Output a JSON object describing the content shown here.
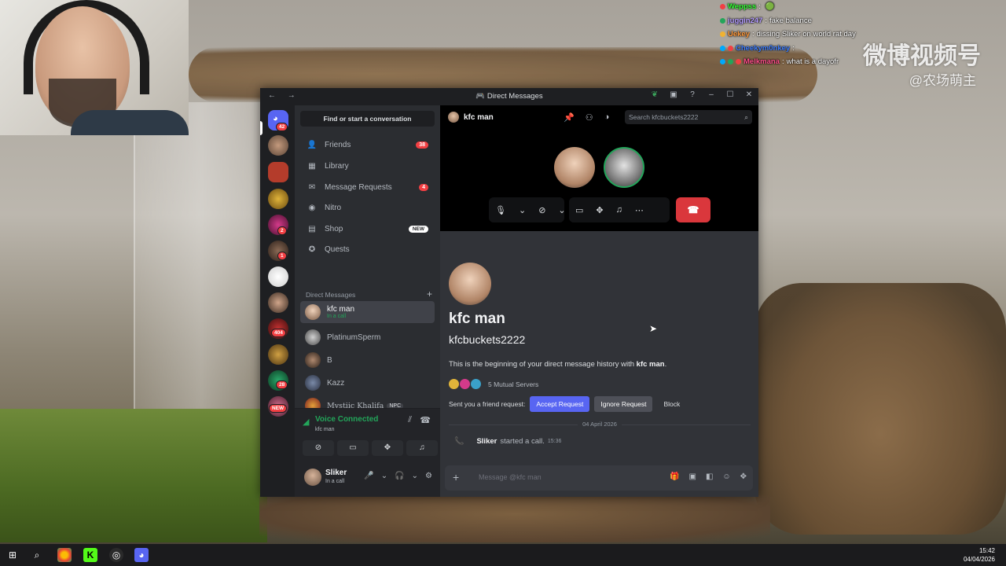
{
  "chat_overlay": {
    "lines": [
      {
        "user": "Weppss",
        "msg": "",
        "color": "#33ff33"
      },
      {
        "user": "juggin247",
        "msg": "fake balance",
        "color": "#b49cff"
      },
      {
        "user": "Uekey",
        "msg": "dissing Sliker on world rat day",
        "color": "#ff9a3c"
      },
      {
        "user": "Cheekym0nkey",
        "msg": "",
        "color": "#3c7dff"
      },
      {
        "user": "Melkmana",
        "msg": "what is a dayofr",
        "color": "#ff4f8b"
      }
    ],
    "watermark": "微博视频号",
    "watermark_handle": "@农场萌主"
  },
  "window": {
    "title": "Direct Messages",
    "nav": "← →"
  },
  "servers": [
    {
      "badge": "42"
    },
    {
      "badge": ""
    },
    {
      "badge": ""
    },
    {
      "badge": ""
    },
    {
      "badge": "2"
    },
    {
      "badge": "1"
    },
    {
      "badge": ""
    },
    {
      "badge": ""
    },
    {
      "badge": "404"
    },
    {
      "badge": ""
    },
    {
      "badge": "28"
    },
    {
      "badge": "NEW"
    }
  ],
  "sidebar": {
    "find_placeholder": "Find or start a conversation",
    "items": [
      {
        "label": "Friends",
        "icon": "friends-icon",
        "count": "38"
      },
      {
        "label": "Library",
        "icon": "library-icon",
        "count": ""
      },
      {
        "label": "Message Requests",
        "icon": "message-requests-icon",
        "count": "4"
      },
      {
        "label": "Nitro",
        "icon": "nitro-icon",
        "count": ""
      },
      {
        "label": "Shop",
        "icon": "shop-icon",
        "count": "NEW"
      },
      {
        "label": "Quests",
        "icon": "quests-icon",
        "count": ""
      }
    ],
    "dm_header": "Direct Messages",
    "dms": [
      {
        "name": "kfc man",
        "status": "In a call"
      },
      {
        "name": "PlatinumSperm",
        "status": ""
      },
      {
        "name": "B",
        "status": ""
      },
      {
        "name": "Kazz",
        "status": ""
      },
      {
        "name": "Mystiic Khalifa",
        "status": "",
        "tag": "NPC"
      }
    ]
  },
  "voice": {
    "label": "Voice Connected",
    "channel": "kfc man"
  },
  "user": {
    "name": "Sliker",
    "status": "In a call"
  },
  "header": {
    "name": "kfc man",
    "search_placeholder": "Search kfcbuckets2222"
  },
  "profile": {
    "display_name": "kfc man",
    "username": "kfcbuckets2222",
    "begin_prefix": "This is the beginning of your direct message history with ",
    "begin_name": "kfc man",
    "begin_suffix": ".",
    "mutual": "5 Mutual Servers",
    "request_text": "Sent you a friend request:",
    "accept": "Accept Request",
    "ignore": "Ignore Request",
    "block": "Block"
  },
  "messages": {
    "date": "04 April 2026",
    "call_user": "Sliker",
    "call_text": "started a call.",
    "call_time": "15:36"
  },
  "composer": {
    "placeholder": "Message @kfc man"
  },
  "taskbar": {
    "time": "15:42",
    "date": "04/04/2026"
  }
}
